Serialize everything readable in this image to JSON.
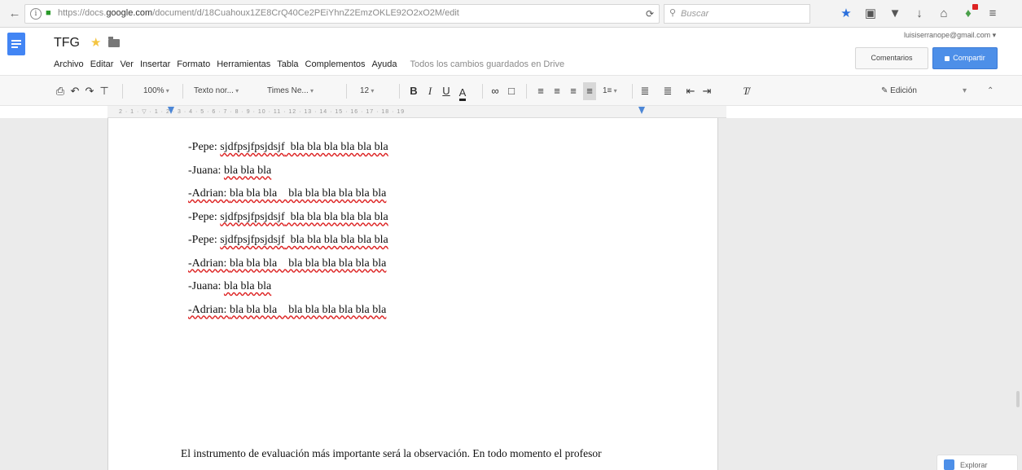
{
  "browser": {
    "url_prefix": "https://docs.",
    "url_domain": "google.com",
    "url_path": "/document/d/18Cuahoux1ZE8CrQ40Ce2PEiYhnZ2EmzOKLE92O2xO2M/edit",
    "search_placeholder": "Buscar"
  },
  "header": {
    "doc_title": "TFG",
    "account_email": "luisiserranope@gmail.com ▾",
    "comments_label": "Comentarios",
    "share_label": "Compartir",
    "menu": [
      "Archivo",
      "Editar",
      "Ver",
      "Insertar",
      "Formato",
      "Herramientas",
      "Tabla",
      "Complementos",
      "Ayuda"
    ],
    "save_status": "Todos los cambios guardados en Drive"
  },
  "toolbar": {
    "zoom": "100%",
    "style": "Texto nor...",
    "font": "Times Ne...",
    "size": "12",
    "bold": "B",
    "italic": "I",
    "underline": "U",
    "text_color": "A",
    "line_spacing": "1≡",
    "mode": "Edición"
  },
  "ruler_text": "2 · 1 · ▽ · 1 · 2 · 3 · 4 · 5 · 6 · 7 · 8 · 9 · 10 · 11 · 12 · 13 · 14 · 15 · 16 · 17 · 18 · 19",
  "document": {
    "lines": [
      {
        "speaker": "-Pepe: ",
        "word": "sjdfpsjfpsjdsjf",
        "rest": "  bla bla bla bla bla bla"
      },
      {
        "speaker": "-Juana: ",
        "word": "",
        "rest": "bla bla bla"
      },
      {
        "speaker": "-Adrian: ",
        "word": "",
        "rest": "bla bla bla    bla bla bla bla bla bla"
      },
      {
        "speaker": "-Pepe: ",
        "word": "sjdfpsjfpsjdsjf",
        "rest": "  bla bla bla bla bla bla"
      },
      {
        "speaker": "-Pepe: ",
        "word": "sjdfpsjfpsjdsjf",
        "rest": "  bla bla bla bla bla bla"
      },
      {
        "speaker": "-Adrian: ",
        "word": "",
        "rest": "bla bla bla    bla bla bla bla bla bla"
      },
      {
        "speaker": "-Juana: ",
        "word": "",
        "rest": "bla bla bla"
      },
      {
        "speaker": "-Adrian: ",
        "word": "",
        "rest": "bla bla bla    bla bla bla bla bla bla"
      }
    ],
    "paragraph": "El instrumento de evaluación más importante será la observación. En todo momento el profesor"
  },
  "explore_label": "Explorar"
}
